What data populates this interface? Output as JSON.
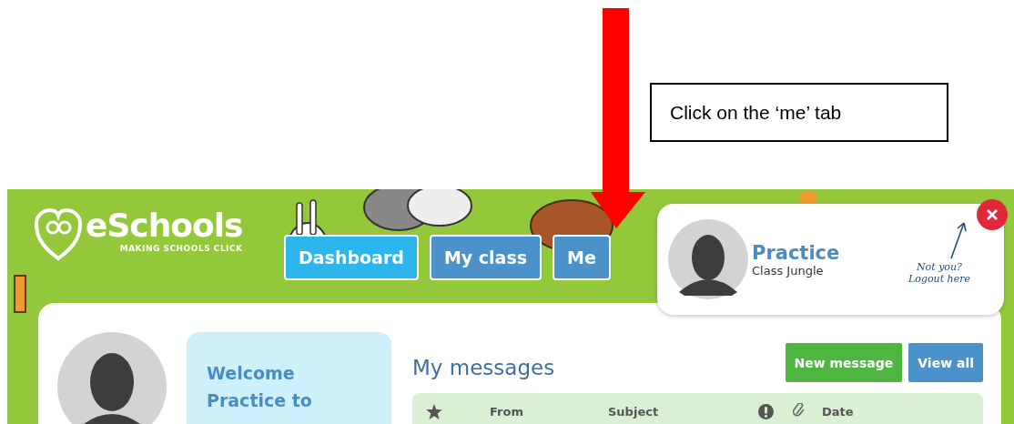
{
  "annotation": {
    "instruction": "Click on the ‘me’ tab"
  },
  "logo": {
    "name": "eSchools",
    "tagline": "MAKING SCHOOLS CLICK"
  },
  "nav_tabs": [
    {
      "label": "Dashboard",
      "selected": true
    },
    {
      "label": "My class",
      "selected": false
    },
    {
      "label": "Me",
      "selected": false
    }
  ],
  "profile_popup": {
    "name": "Practice",
    "class": "Class Jungle",
    "logout_hint": [
      "Not you?",
      "Logout here"
    ]
  },
  "welcome": {
    "message": "Welcome Practice to"
  },
  "messages": {
    "title": "My messages",
    "buttons": [
      {
        "label": "New message",
        "kind": "primary"
      },
      {
        "label": "View all",
        "kind": "secondary"
      }
    ],
    "columns": [
      {
        "kind": "star"
      },
      {
        "kind": "text",
        "label": "From"
      },
      {
        "kind": "text",
        "label": "Subject"
      },
      {
        "kind": "priority"
      },
      {
        "kind": "attachment"
      },
      {
        "kind": "text",
        "label": "Date"
      }
    ]
  }
}
